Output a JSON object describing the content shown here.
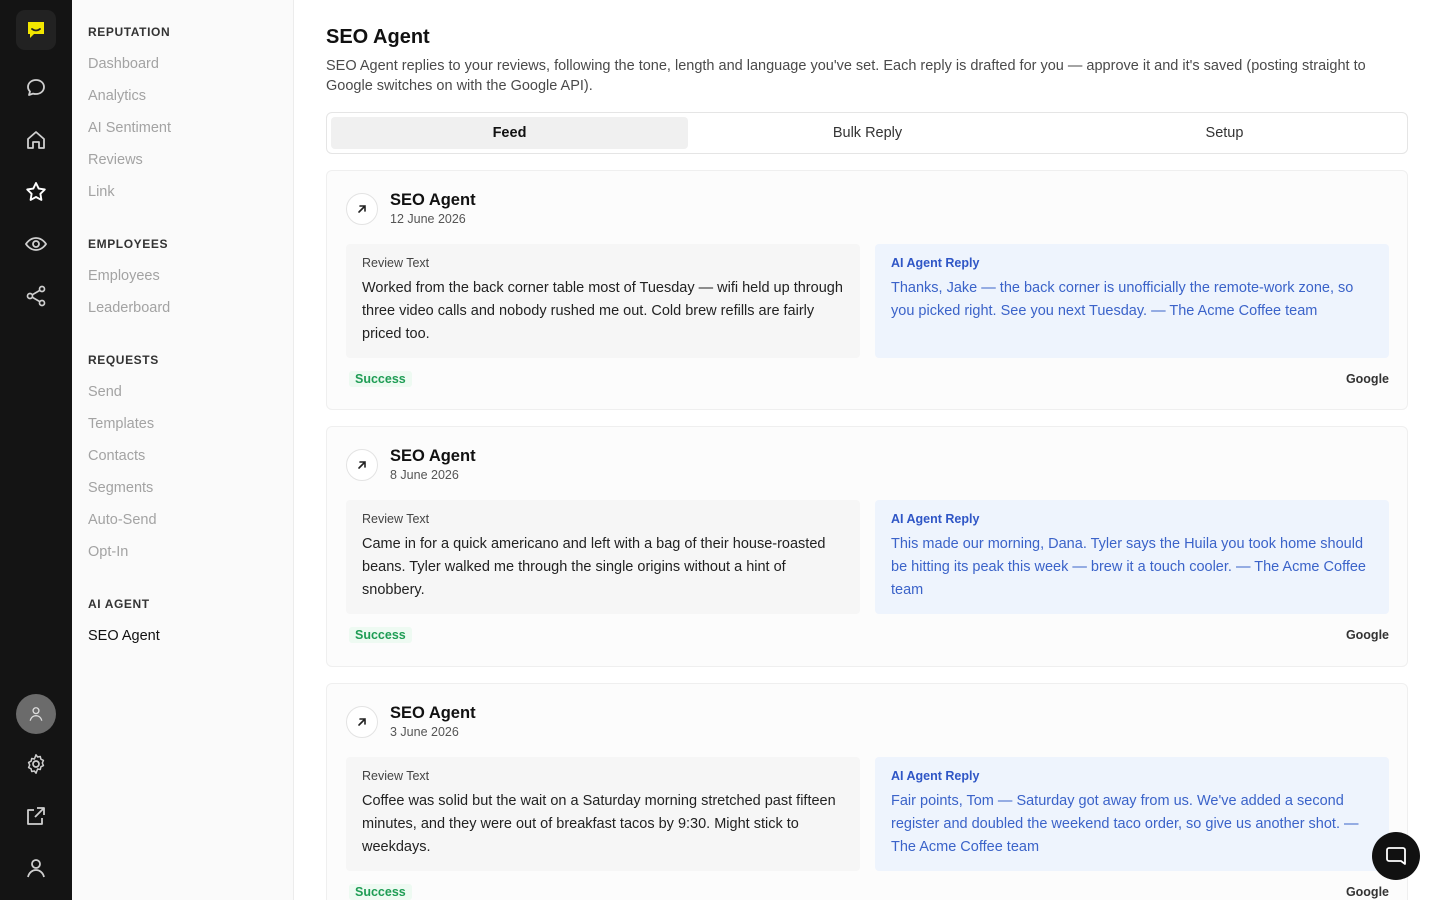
{
  "sidebar": {
    "sections": [
      {
        "heading": "REPUTATION",
        "items": [
          "Dashboard",
          "Analytics",
          "AI Sentiment",
          "Reviews",
          "Link"
        ]
      },
      {
        "heading": "EMPLOYEES",
        "items": [
          "Employees",
          "Leaderboard"
        ]
      },
      {
        "heading": "REQUESTS",
        "items": [
          "Send",
          "Templates",
          "Contacts",
          "Segments",
          "Auto-Send",
          "Opt-In"
        ]
      },
      {
        "heading": "AI AGENT",
        "items": [
          "SEO Agent"
        ]
      }
    ],
    "active_item": "SEO Agent"
  },
  "page": {
    "title": "SEO Agent",
    "description": "SEO Agent replies to your reviews, following the tone, length and language you've set. Each reply is drafted for you — approve it and it's saved (posting straight to Google switches on with the Google API)."
  },
  "tabs": [
    {
      "label": "Feed",
      "active": true
    },
    {
      "label": "Bulk Reply",
      "active": false
    },
    {
      "label": "Setup",
      "active": false
    }
  ],
  "feed": [
    {
      "title": "SEO Agent",
      "date": "12 June 2026",
      "review_label": "Review Text",
      "review_text": "Worked from the back corner table most of Tuesday — wifi held up through three video calls and nobody rushed me out. Cold brew refills are fairly priced too.",
      "reply_label": "AI Agent Reply",
      "reply_text": "Thanks, Jake — the back corner is unofficially the remote-work zone, so you picked right. See you next Tuesday. — The Acme Coffee team",
      "status": "Success",
      "source": "Google"
    },
    {
      "title": "SEO Agent",
      "date": "8 June 2026",
      "review_label": "Review Text",
      "review_text": "Came in for a quick americano and left with a bag of their house-roasted beans. Tyler walked me through the single origins without a hint of snobbery.",
      "reply_label": "AI Agent Reply",
      "reply_text": "This made our morning, Dana. Tyler says the Huila you took home should be hitting its peak this week — brew it a touch cooler. — The Acme Coffee team",
      "status": "Success",
      "source": "Google"
    },
    {
      "title": "SEO Agent",
      "date": "3 June 2026",
      "review_label": "Review Text",
      "review_text": "Coffee was solid but the wait on a Saturday morning stretched past fifteen minutes, and they were out of breakfast tacos by 9:30. Might stick to weekdays.",
      "reply_label": "AI Agent Reply",
      "reply_text": "Fair points, Tom — Saturday got away from us. We've added a second register and doubled the weekend taco order, so give us another shot. — The Acme Coffee team",
      "status": "Success",
      "source": "Google"
    }
  ],
  "colors": {
    "rail_bg": "#141414",
    "brand_yellow": "#f2e600",
    "reply_bg": "#eef4fd",
    "reply_text": "#3b63c9",
    "success": "#1f9d55"
  },
  "icons": {
    "rail": [
      "logo-chat-icon",
      "chat-bubble-icon",
      "home-icon",
      "star-icon",
      "eye-icon",
      "share-icon",
      "avatar-icon",
      "gear-icon",
      "external-link-icon",
      "user-icon"
    ],
    "card": "arrow-up-right-icon",
    "fab": "chat-icon"
  }
}
